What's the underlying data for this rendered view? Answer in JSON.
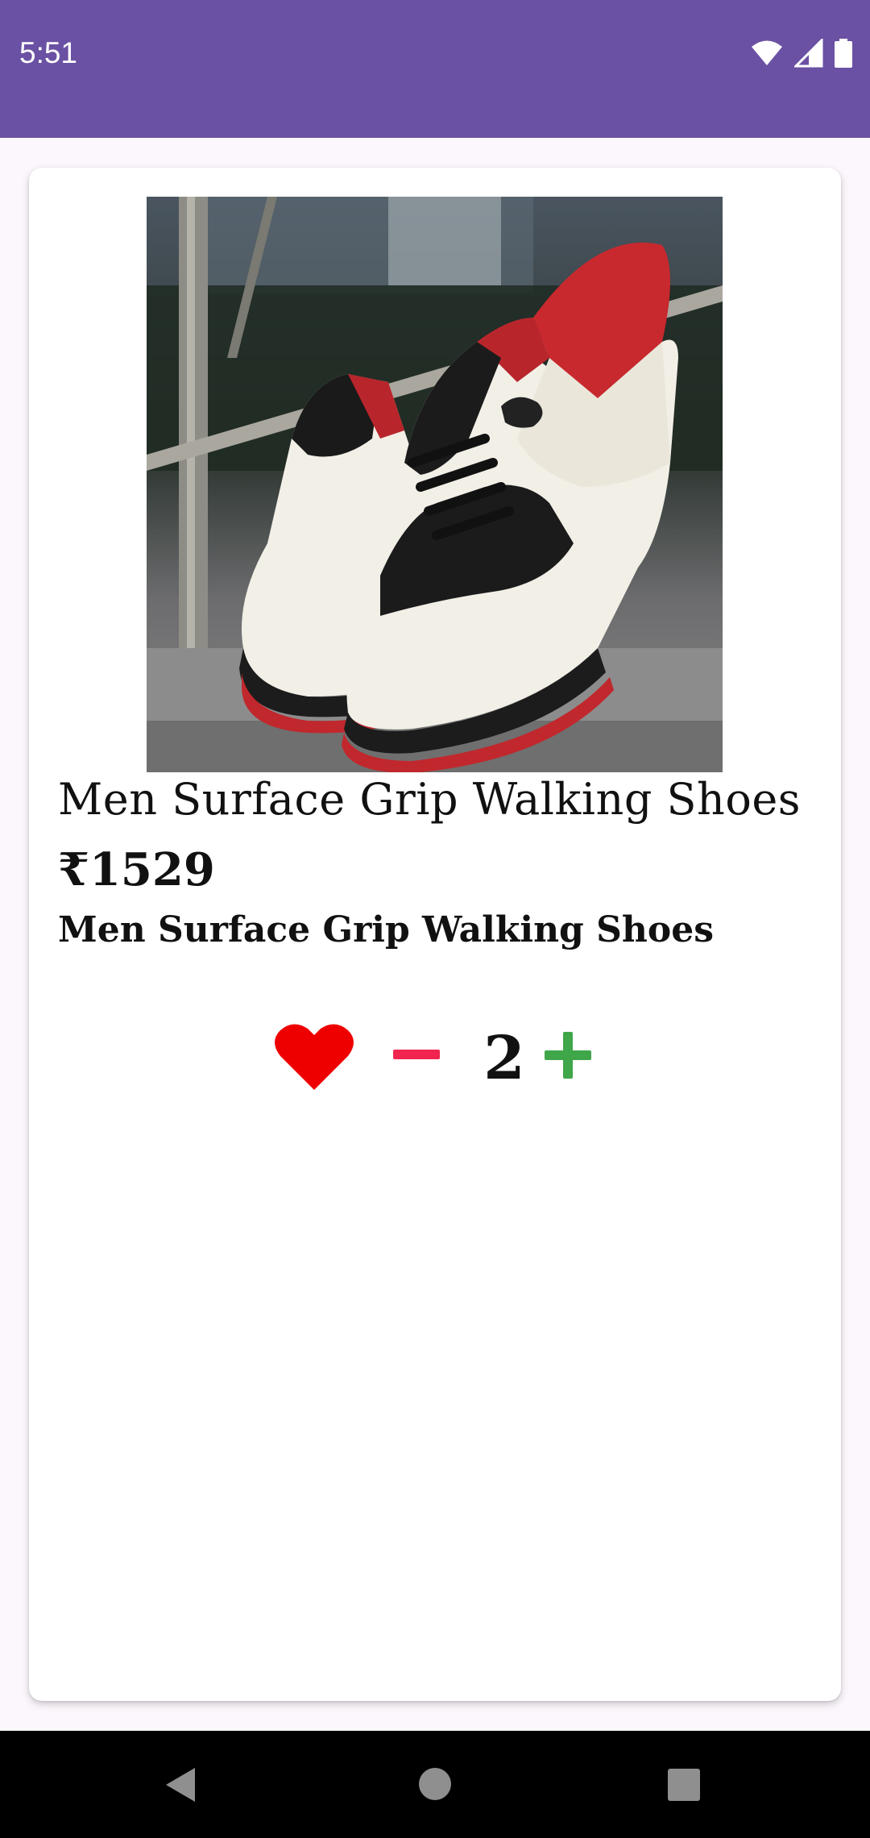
{
  "status_bar": {
    "time": "5:51",
    "icons": [
      "wifi-icon",
      "cellular-signal-icon",
      "battery-icon"
    ],
    "background_color": "#6a51a3"
  },
  "product": {
    "image_alt": "Men Surface Grip Walking Shoes",
    "title": "Men Surface Grip Walking Shoes",
    "price": "₹1529",
    "description": "Men Surface Grip Walking Shoes",
    "quantity": "2",
    "favorite": true
  },
  "actions": {
    "favorite_icon": "heart-icon",
    "decrease_icon": "minus-icon",
    "increase_icon": "plus-icon",
    "favorite_color": "#ee0000",
    "decrease_color": "#f0244f",
    "increase_color": "#3fa64a"
  },
  "navigation": {
    "back_icon": "back-triangle-icon",
    "home_icon": "home-circle-icon",
    "recents_icon": "recents-square-icon"
  }
}
